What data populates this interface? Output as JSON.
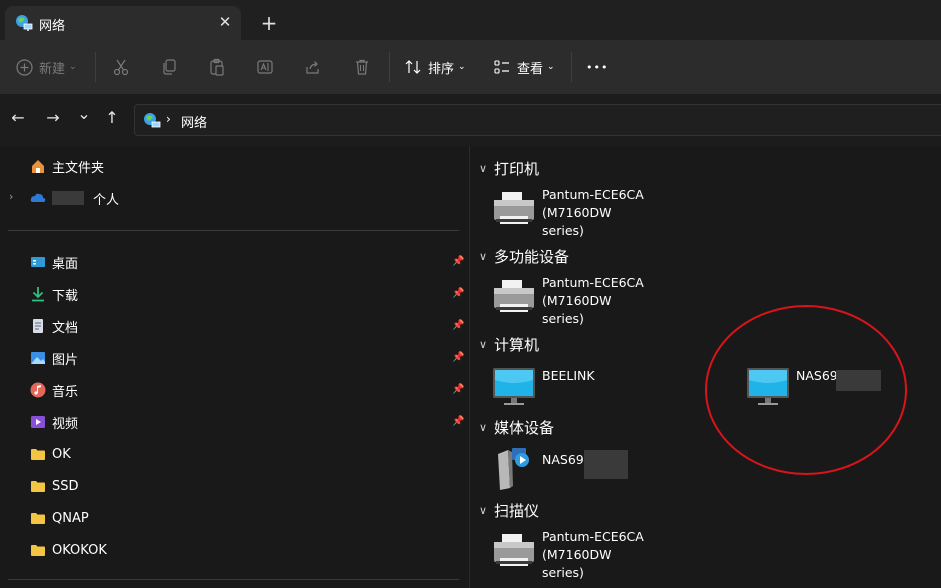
{
  "window": {
    "tab_title": "网络",
    "close_tab_glyph": "✕",
    "new_tab_glyph": "+"
  },
  "toolbar": {
    "new_label": "新建",
    "sort_label": "排序",
    "view_label": "查看",
    "more_glyph": "•••",
    "icons": [
      "cut-icon",
      "copy-icon",
      "paste-icon",
      "rename-icon",
      "share-icon",
      "delete-icon"
    ]
  },
  "nav": {
    "back_glyph": "←",
    "forward_glyph": "→",
    "recent_glyph": "⌄",
    "up_glyph": "↑",
    "breadcrumb_sep": "›",
    "breadcrumb": "网络"
  },
  "sidebar": {
    "home": "主文件夹",
    "personal": "个人",
    "items": [
      {
        "label": "桌面",
        "icon": "desktop-icon",
        "pinned": true
      },
      {
        "label": "下载",
        "icon": "download-icon",
        "pinned": true
      },
      {
        "label": "文档",
        "icon": "document-icon",
        "pinned": true
      },
      {
        "label": "图片",
        "icon": "pictures-icon",
        "pinned": true
      },
      {
        "label": "音乐",
        "icon": "music-icon",
        "pinned": true
      },
      {
        "label": "视频",
        "icon": "video-icon",
        "pinned": true
      },
      {
        "label": "OK",
        "icon": "folder-icon",
        "pinned": false
      },
      {
        "label": "SSD",
        "icon": "folder-icon",
        "pinned": false
      },
      {
        "label": "QNAP",
        "icon": "folder-icon",
        "pinned": false
      },
      {
        "label": "OKOKOK",
        "icon": "folder-icon",
        "pinned": false
      }
    ]
  },
  "groups": {
    "printers": {
      "title": "打印机",
      "devices": [
        {
          "line1": "Pantum-ECE6CA (M7160DW",
          "line2": "series)"
        }
      ]
    },
    "multifunction": {
      "title": "多功能设备",
      "devices": [
        {
          "line1": "Pantum-ECE6CA (M7160DW",
          "line2": "series)"
        }
      ]
    },
    "computers": {
      "title": "计算机",
      "devices": [
        {
          "name": "BEELINK"
        },
        {
          "name": "NAS69"
        }
      ]
    },
    "media": {
      "title": "媒体设备",
      "devices": [
        {
          "name": "NAS69("
        }
      ]
    },
    "scanners": {
      "title": "扫描仪",
      "devices": [
        {
          "line1": "Pantum-ECE6CA (M7160DW",
          "line2": "series)"
        }
      ]
    }
  },
  "colors": {
    "annotation_circle": "#d9141a",
    "accent": "#4cc2ff"
  }
}
